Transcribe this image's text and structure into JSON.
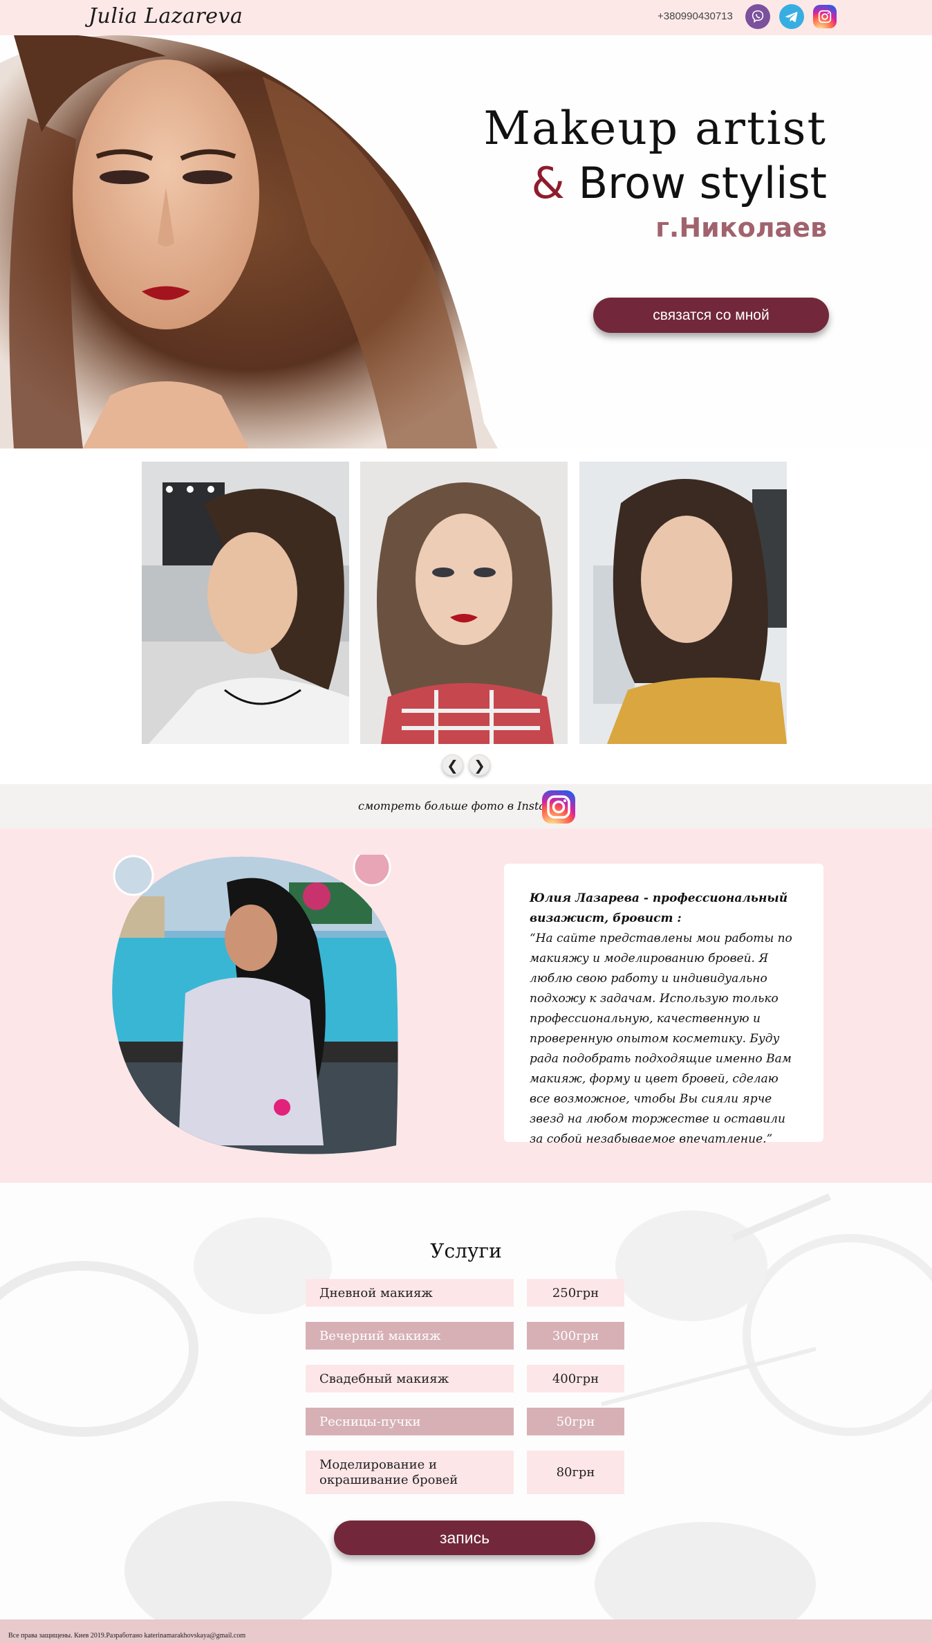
{
  "header": {
    "logo": "Julia Lazareva",
    "phone": "+380990430713",
    "social": [
      {
        "name": "viber-icon",
        "color": "#7b519d"
      },
      {
        "name": "telegram-icon",
        "color": "#37aee2"
      },
      {
        "name": "instagram-icon",
        "color": "#d6249f"
      }
    ]
  },
  "hero": {
    "line1": "Makeup artist",
    "ampersand": "&",
    "line2": " Brow stylist",
    "city": "г.Николаев",
    "contact_button": "связатся со мной"
  },
  "gallery": {
    "prev": "❮",
    "next": "❯"
  },
  "instagram": {
    "link_text": "смотреть больше фото в Instagram"
  },
  "about": {
    "heading": "Юлия Лазарева - профессиональный визажист, бровист :",
    "quote": "“На сайте представлены мои работы по макияжу и моделированию бровей. Я люблю свою работу и индивидуально подхожу к задачам. Использую только профессиональную, качественную и проверенную опытом косметику. Буду рада подобрать подходящие именно Вам макияж, форму и цвет бровей, сделаю все возможное, чтобы Вы сияли ярче звезд на любом торжестве и оставили за собой незабываемое впечатление.”"
  },
  "services": {
    "title": "Услуги",
    "items": [
      {
        "name": "Дневной макияж",
        "price": "250грн"
      },
      {
        "name": "Вечерний макияж",
        "price": "300грн"
      },
      {
        "name": "Свадебный макияж",
        "price": "400грн"
      },
      {
        "name": "Ресницы-пучки",
        "price": "50грн"
      },
      {
        "name": "Моделирование и окрашивание бровей",
        "price": "80грн"
      }
    ],
    "book_button": "запись"
  },
  "footer": {
    "text": "Все права защищены. Киев 2019.Разработано katerinamarakhovskaya@gmail.com"
  },
  "colors": {
    "brand": "#72283a",
    "pink_bg": "#fde6e8",
    "accent": "#8e1d2c"
  }
}
